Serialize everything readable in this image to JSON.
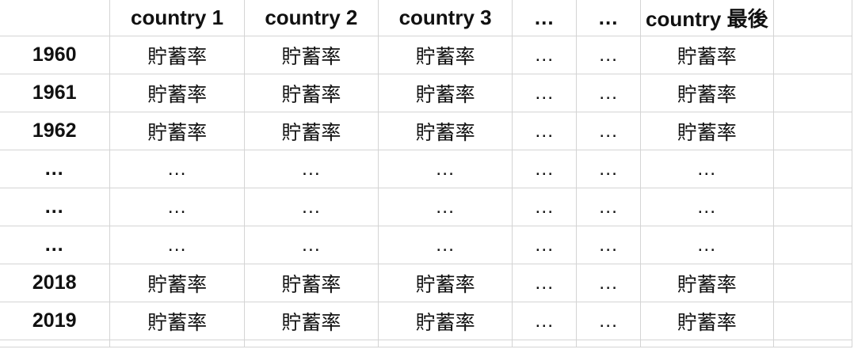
{
  "spreadsheet": {
    "header": [
      "",
      "country 1",
      "country 2",
      "country 3",
      "…",
      "…",
      "country 最後"
    ],
    "rows": [
      [
        "1960",
        "貯蓄率",
        "貯蓄率",
        "貯蓄率",
        "…",
        "…",
        "貯蓄率"
      ],
      [
        "1961",
        "貯蓄率",
        "貯蓄率",
        "貯蓄率",
        "…",
        "…",
        "貯蓄率"
      ],
      [
        "1962",
        "貯蓄率",
        "貯蓄率",
        "貯蓄率",
        "…",
        "…",
        "貯蓄率"
      ],
      [
        "…",
        "…",
        "…",
        "…",
        "…",
        "…",
        "…"
      ],
      [
        "…",
        "…",
        "…",
        "…",
        "…",
        "…",
        "…"
      ],
      [
        "…",
        "…",
        "…",
        "…",
        "…",
        "…",
        "…"
      ],
      [
        "2018",
        "貯蓄率",
        "貯蓄率",
        "貯蓄率",
        "…",
        "…",
        "貯蓄率"
      ],
      [
        "2019",
        "貯蓄率",
        "貯蓄率",
        "貯蓄率",
        "…",
        "…",
        "貯蓄率"
      ]
    ]
  }
}
